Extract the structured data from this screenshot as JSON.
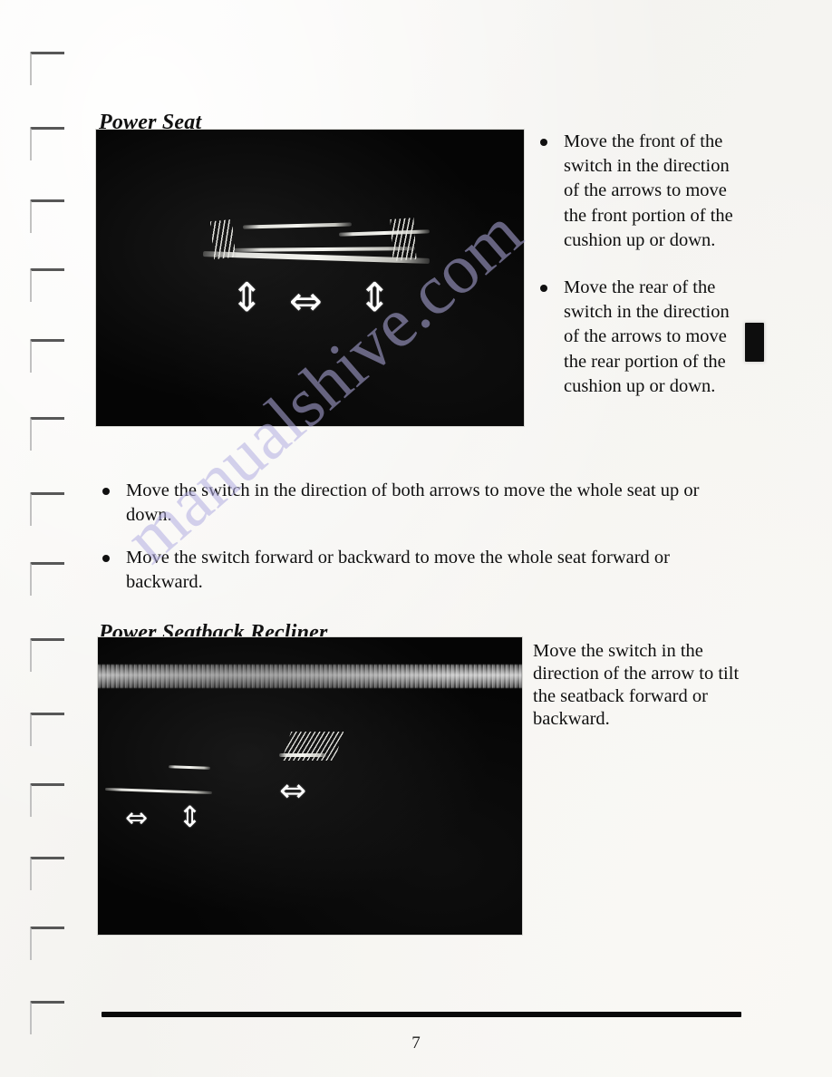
{
  "document": {
    "page_number": "7",
    "watermark_text": "manualshive.com",
    "background_color": "#f6f5f3",
    "ink_color": "#0f0f0f",
    "watermark_color": "#b3aee2",
    "tab_mark_color": "#0d0d0d"
  },
  "sections": [
    {
      "id": "power-seat",
      "heading": "Power Seat",
      "photo": {
        "caption_alt": "Power seat control switch on side of seat with up-down, left-right and up-down arrows",
        "arrows": [
          {
            "name": "up-down-arrow-front",
            "glyph": "⇕"
          },
          {
            "name": "left-right-arrow-whole",
            "glyph": "⇔"
          },
          {
            "name": "up-down-arrow-rear",
            "glyph": "⇕"
          }
        ]
      },
      "side_bullets": [
        "Move the front of the switch in the direction of the arrows to move the front portion of the cushion up or down.",
        "Move the rear of the switch in the direction of the arrows to move the rear portion of the cushion up or down."
      ],
      "wide_bullets": [
        "Move the switch in the direction of both arrows to move the whole seat up or down.",
        "Move the switch forward or backward to move the whole seat forward or backward."
      ]
    },
    {
      "id": "power-seatback-recliner",
      "heading": "Power Seatback Recliner",
      "photo": {
        "caption_alt": "Power seatback recliner switch with left-right tilt arrow",
        "arrows": [
          {
            "name": "left-right-arrow-recliner",
            "glyph": "⇔"
          },
          {
            "name": "left-right-arrow-seat",
            "glyph": "⇔"
          },
          {
            "name": "up-down-arrow-seat",
            "glyph": "⇕"
          }
        ]
      },
      "note": "Move the switch in the direction of the arrow to tilt the seatback forward or backward."
    }
  ]
}
